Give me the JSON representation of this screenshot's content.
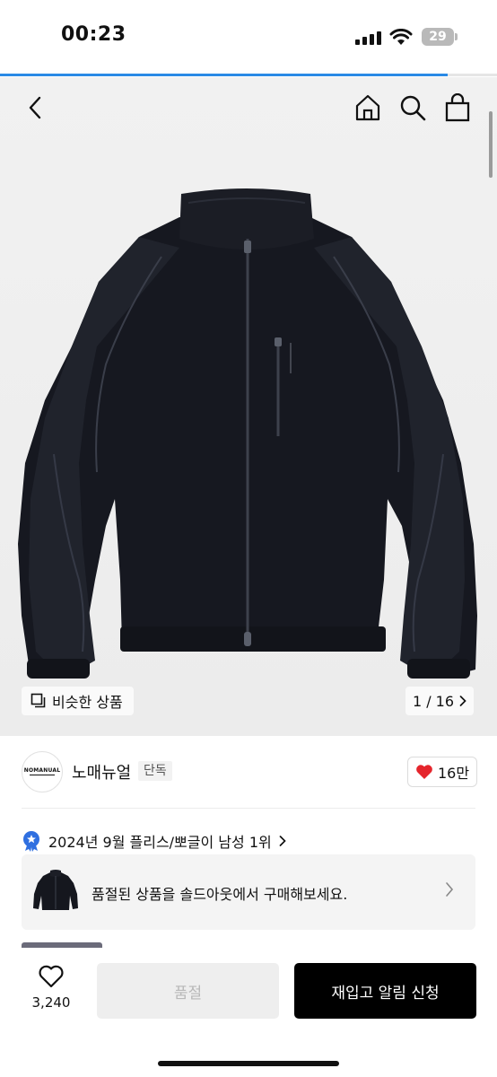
{
  "status_bar": {
    "time": "00:23",
    "battery": "29"
  },
  "page_progress": 0.9,
  "gallery": {
    "similar_label": "비슷한 상품",
    "counter": "1 / 16"
  },
  "brand": {
    "logo_text": "NOMANUAL",
    "name": "노매뉴얼",
    "badge": "단독",
    "likes": "16만"
  },
  "ranking": {
    "text": "2024년 9월 플리스/뽀글이 남성 1위"
  },
  "soldout_card": {
    "text": "품절된 상품을 솔드아웃에서 구매해보세요."
  },
  "bottom": {
    "wish_count": "3,240",
    "soldout_label": "품절",
    "restock_label": "재입고 알림 신청"
  },
  "colors": {
    "accent": "#2a8ae6",
    "heart": "#e5252c",
    "rank_badge": "#2f6fe0"
  }
}
